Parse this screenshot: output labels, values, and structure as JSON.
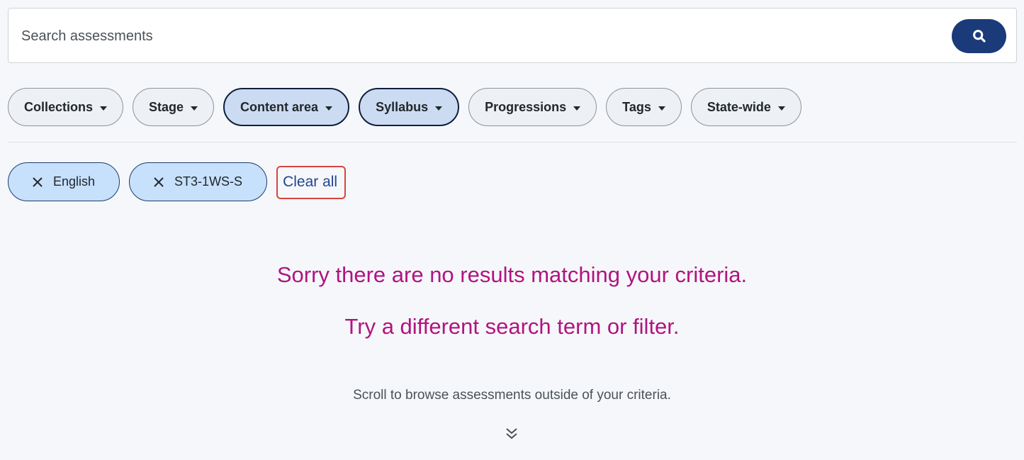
{
  "search": {
    "placeholder": "Search assessments",
    "button_icon": "search-icon"
  },
  "filters": [
    {
      "label": "Collections",
      "active": false
    },
    {
      "label": "Stage",
      "active": false
    },
    {
      "label": "Content area",
      "active": true
    },
    {
      "label": "Syllabus",
      "active": true
    },
    {
      "label": "Progressions",
      "active": false
    },
    {
      "label": "Tags",
      "active": false
    },
    {
      "label": "State-wide",
      "active": false
    }
  ],
  "active_filters": [
    {
      "label": "English"
    },
    {
      "label": "ST3-1WS-S"
    }
  ],
  "clear_all_label": "Clear all",
  "no_results": {
    "line1": "Sorry there are no results matching your criteria.",
    "line2": "Try a different search term or filter."
  },
  "scroll_hint": "Scroll to browse assessments outside of your criteria.",
  "colors": {
    "accent": "#1a3a7a",
    "message": "#b0147f",
    "chip_bg": "#c7e0fc",
    "highlight": "#d8443b"
  }
}
